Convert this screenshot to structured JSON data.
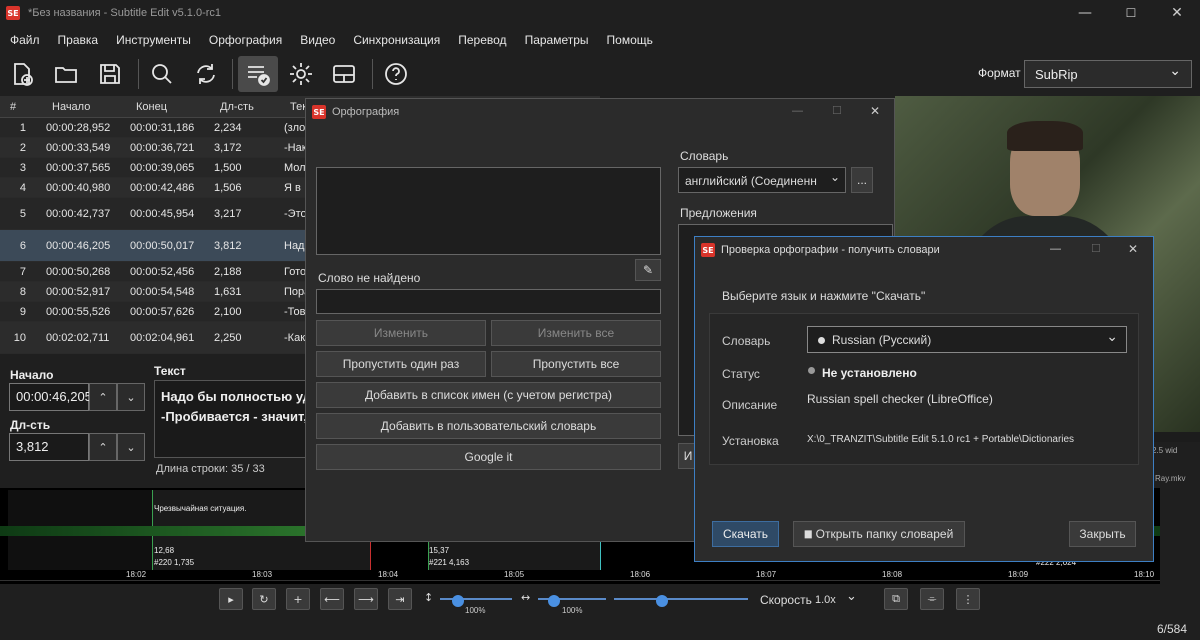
{
  "window": {
    "title": "*Без названия - Subtitle Edit v5.1.0-rc1",
    "logo": "SE",
    "min": "—",
    "max": "☐",
    "close": "✕"
  },
  "menu": [
    "Файл",
    "Правка",
    "Инструменты",
    "Орфография",
    "Видео",
    "Синхронизация",
    "Перевод",
    "Параметры",
    "Помощь"
  ],
  "toolbar": {
    "icons": [
      "new-file-icon",
      "open-folder-icon",
      "save-icon",
      "search-icon",
      "sync-icon",
      "spellcheck-icon",
      "gear-icon",
      "layout-icon",
      "help-icon"
    ],
    "format_label": "Формат",
    "format_value": "SubRip",
    "format_arrow": "⌄"
  },
  "grid": {
    "headers": [
      "#",
      "Начало",
      "Конец",
      "Дл-сть",
      "Текст"
    ],
    "rows": [
      {
        "n": "1",
        "start": "00:00:28,952",
        "end": "00:00:31,186",
        "dur": "2,234",
        "text": "(злоб"
      },
      {
        "n": "2",
        "start": "00:00:33,549",
        "end": "00:00:36,721",
        "dur": "3,172",
        "text": "-Нак"
      },
      {
        "n": "3",
        "start": "00:00:37,565",
        "end": "00:00:39,065",
        "dur": "1,500",
        "text": "Мол"
      },
      {
        "n": "4",
        "start": "00:00:40,980",
        "end": "00:00:42,486",
        "dur": "1,506",
        "text": "Я в"
      },
      {
        "n": "5",
        "start": "00:00:42,737",
        "end": "00:00:45,954",
        "dur": "3,217",
        "text": "-Это чешу"
      },
      {
        "n": "6",
        "start": "00:00:46,205",
        "end": "00:00:50,017",
        "dur": "3,812",
        "text": "Надо -Про"
      },
      {
        "n": "7",
        "start": "00:00:50,268",
        "end": "00:00:52,456",
        "dur": "2,188",
        "text": "Гото"
      },
      {
        "n": "8",
        "start": "00:00:52,917",
        "end": "00:00:54,548",
        "dur": "1,631",
        "text": "Пора"
      },
      {
        "n": "9",
        "start": "00:00:55,526",
        "end": "00:00:57,626",
        "dur": "2,100",
        "text": "-Тов"
      },
      {
        "n": "10",
        "start": "00:02:02,711",
        "end": "00:02:04,961",
        "dur": "2,250",
        "text": "-Как -Так"
      }
    ]
  },
  "edit": {
    "start_label": "Начало",
    "start_value": "00:00:46,205",
    "dur_label": "Дл-сть",
    "dur_value": "3,812",
    "text_label": "Текст",
    "text_line1": "Надо бы полностью удо",
    "text_line2": "-Пробивается - значит,",
    "line_len": "Длина строки:  35 / 33",
    "up": "⌃",
    "down": "⌄"
  },
  "waveform": {
    "cue1_text": "Чрезвычайная ситуация.",
    "cue1_info1": "12,68",
    "cue1_info2": "#220  1,735",
    "cue2_info1": "15,37",
    "cue2_info2": "#221  4,163",
    "cue3_info": "#222  2,024",
    "ticks": [
      "18:02",
      "18:03",
      "18:04",
      "18:05",
      "18:06",
      "18:07",
      "18:08",
      "18:09",
      "18:10"
    ]
  },
  "controls": {
    "play": "▸",
    "loop": "↻",
    "plus": "+",
    "back": "⟵",
    "fwd": "⟶",
    "mark": "⇥",
    "vzoom_icon": "↕",
    "vzoom": "100%",
    "hzoom_icon": "↔",
    "hzoom": "100%",
    "speed_label": "Скорость",
    "speed_value": "1.0x",
    "speed_arrow": "⌄",
    "counter": "6/584",
    "btn_a": "⧉",
    "btn_b": "⌯",
    "btn_c": "⋮"
  },
  "video": {
    "info1": "2.5 wid",
    "info2": "Ray.mkv"
  },
  "spell": {
    "title": "Орфография",
    "logo": "SE",
    "min": "—",
    "max": "☐",
    "close": "✕",
    "word_not_found": "Слово не найдено",
    "btn_change": "Изменить",
    "btn_change_all": "Изменить все",
    "btn_skip_once": "Пропустить один раз",
    "btn_skip_all": "Пропустить все",
    "btn_add_names": "Добавить в список имен (с учетом регистра)",
    "btn_add_user": "Добавить в пользовательский словарь",
    "btn_google": "Google it",
    "dict_label": "Словарь",
    "dict_value": "английский (Соединенн",
    "dict_arrow": "⌄",
    "dict_more": "...",
    "suggestions_label": "Предложения",
    "pencil": "✎",
    "partial_btn": "И"
  },
  "getdict": {
    "title": "Проверка орфографии - получить словари",
    "logo": "SE",
    "min": "—",
    "max": "☐",
    "close": "✕",
    "instruction": "Выберите язык и нажмите \"Скачать\"",
    "dict_label": "Словарь",
    "dict_value": "Russian (Русский)",
    "dict_arrow": "⌄",
    "status_label": "Статус",
    "status_value": "Не установлено",
    "desc_label": "Описание",
    "desc_value": "Russian spell checker (LibreOffice)",
    "install_label": "Установка",
    "install_value": "X:\\0_TRANZIT\\Subtitle Edit 5.1.0 rc1 + Portable\\Dictionaries",
    "btn_download": "Скачать",
    "btn_open_folder": "Открыть папку словарей",
    "btn_close": "Закрыть",
    "folder_icon": "▆"
  }
}
